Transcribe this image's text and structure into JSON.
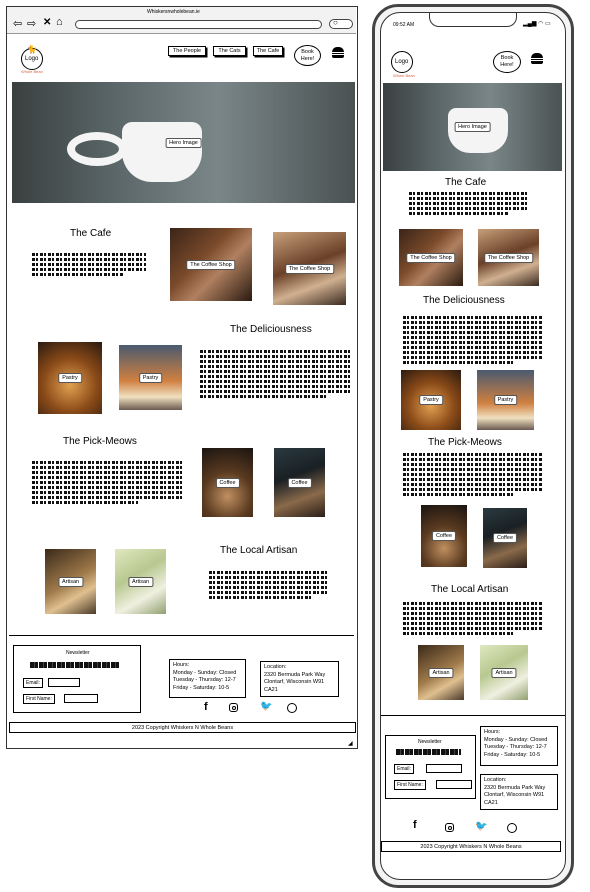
{
  "browser": {
    "url": "Whiskersnwholebean.ie"
  },
  "nav": {
    "logo": "Logo",
    "logo_sub": "Whole Bean",
    "links": [
      "The People",
      "The Cats",
      "The Cafe"
    ],
    "book": "Book Here!"
  },
  "hero": {
    "label": "Hero Image"
  },
  "sections": {
    "cafe": {
      "title": "The Cafe",
      "img": "The Coffee Shop"
    },
    "delicious": {
      "title": "The Deliciousness",
      "img": "Pastry"
    },
    "pickmeows": {
      "title": "The Pick-Meows",
      "img": "Coffee"
    },
    "artisan": {
      "title": "The Local Artisan",
      "img": "Artisan"
    }
  },
  "footer": {
    "newsletter": "Newsletter",
    "email": "Email:",
    "first_name": "First Name:",
    "hours_title": "Hours:",
    "hours": [
      "Monday - Sunday: Closed",
      "Tuesday - Thursday: 12-7",
      "Friday - Saturday: 10-5"
    ],
    "location_title": "Location:",
    "location": [
      "2320 Bermuda Park Way",
      "Clontarf, Wisconsin W91",
      "CA21"
    ],
    "copyright": "2023 Copyright Whiskers N Whole Beans",
    "social_icons": [
      "facebook-icon",
      "instagram-icon",
      "twitter-icon",
      "whatsapp-icon"
    ]
  },
  "mobile": {
    "time": "09:52 AM"
  }
}
